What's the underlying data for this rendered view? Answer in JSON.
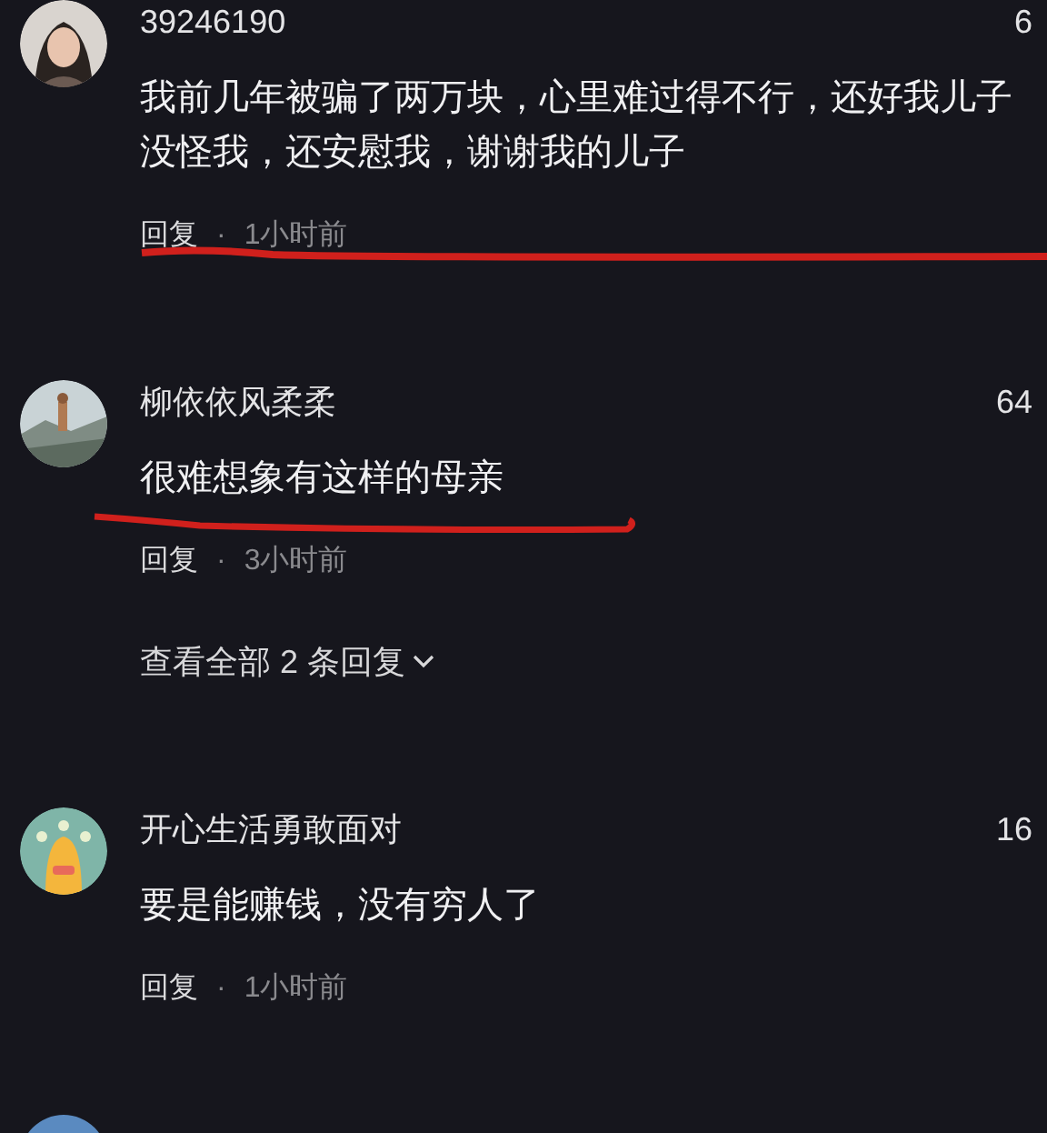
{
  "comments": [
    {
      "username": "39246190",
      "likes": "6",
      "text": "我前几年被骗了两万块，心里难过得不行，还好我儿子没怪我，还安慰我，谢谢我的儿子",
      "reply_label": "回复",
      "separator": "·",
      "time": "1小时前"
    },
    {
      "username": "柳依依风柔柔",
      "likes": "64",
      "text": "很难想象有这样的母亲",
      "reply_label": "回复",
      "separator": "·",
      "time": "3小时前",
      "view_replies": "查看全部 2 条回复"
    },
    {
      "username": "开心生活勇敢面对",
      "likes": "16",
      "text": "要是能赚钱，没有穷人了",
      "reply_label": "回复",
      "separator": "·",
      "time": "1小时前"
    }
  ]
}
